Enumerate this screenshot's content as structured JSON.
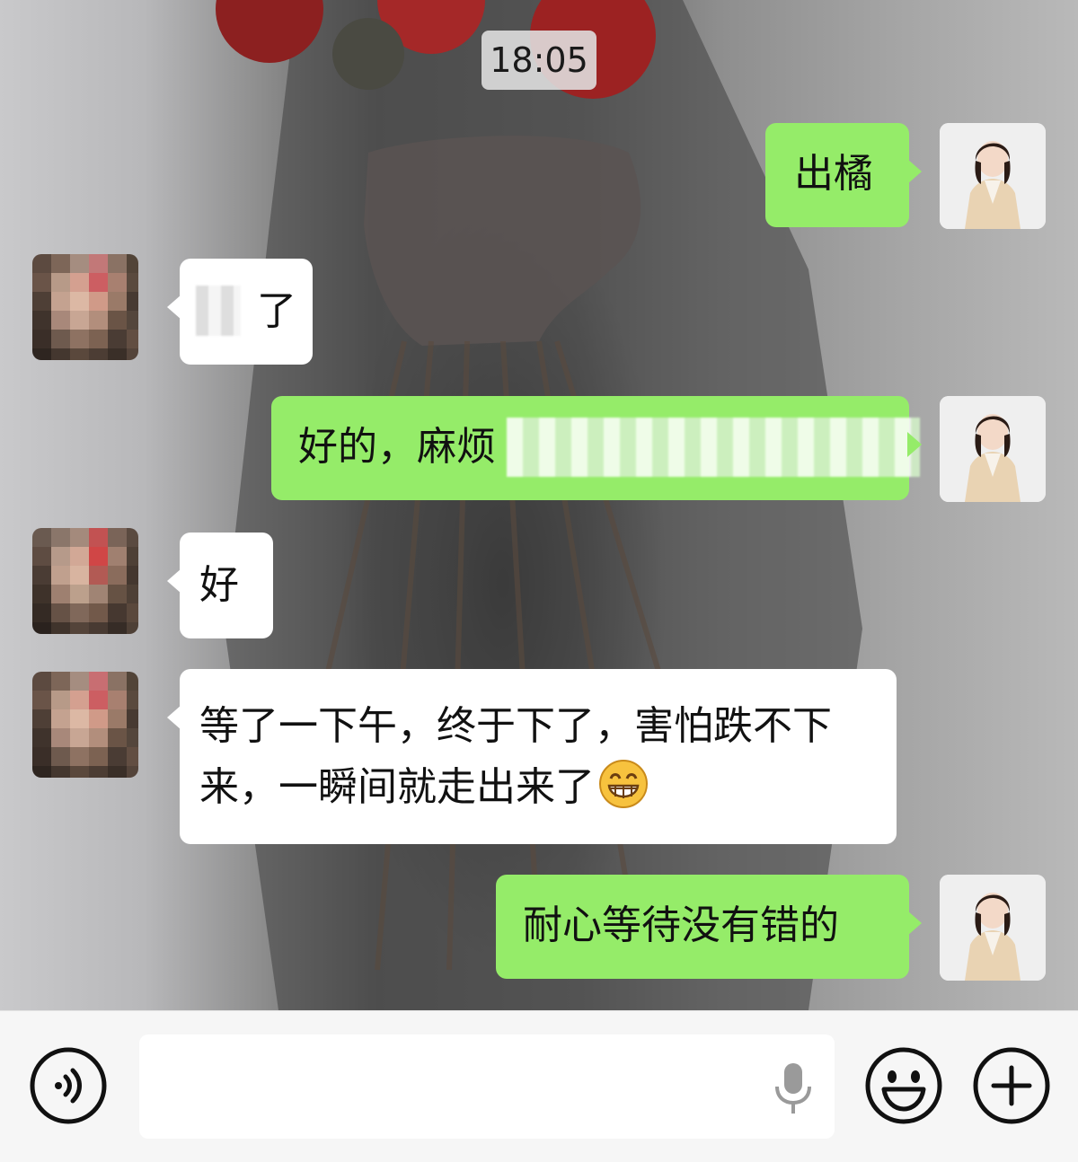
{
  "chat": {
    "timestamp": "18:05",
    "messages": [
      {
        "side": "me",
        "text": "出橘"
      },
      {
        "side": "other",
        "text": "了"
      },
      {
        "side": "me",
        "text": "好的，麻烦"
      },
      {
        "side": "other",
        "text": "好"
      },
      {
        "side": "other",
        "text": "等了一下午，终于下了，害怕跌不下来，一瞬间就走出来了"
      },
      {
        "side": "me",
        "text": "耐心等待没有错的"
      }
    ]
  },
  "emojis": {
    "grin": "grinning-face-emoji"
  },
  "input_bar": {
    "voice_icon": "voice-icon",
    "text_value": "",
    "mic_icon": "microphone-icon",
    "emoji_icon": "smiley-icon",
    "add_icon": "plus-icon"
  },
  "colors": {
    "my_bubble": "#95ec69",
    "other_bubble": "#ffffff",
    "input_bar_bg": "#f6f6f6"
  }
}
